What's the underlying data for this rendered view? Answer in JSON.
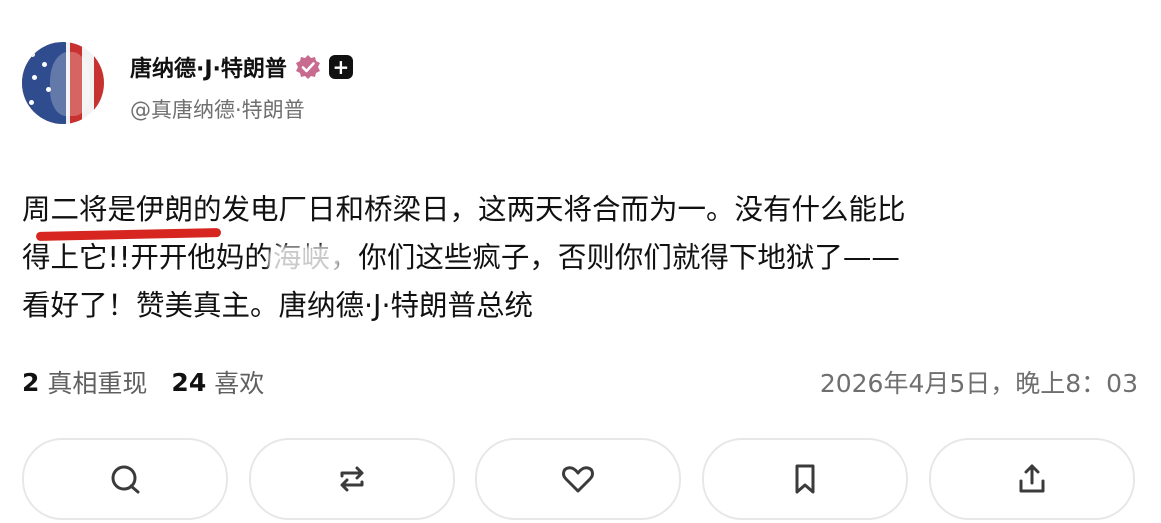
{
  "author": {
    "display_name": "唐纳德·J·特朗普",
    "handle": "@真唐纳德·特朗普",
    "verified_icon": "verified-badge-icon",
    "plus_icon": "plus-box-icon"
  },
  "post": {
    "lines": [
      "周二将是伊朗的发电厂日和桥梁日，这两天将合而为一。没有什么能比",
      "得上它!!开开他妈的海峡，你们这些疯子，否则你们就得下地狱了——",
      "看好了！赞美真主。唐纳德·J·特朗普总统"
    ]
  },
  "stats": {
    "reposts_count": "2",
    "reposts_label": "真相重现",
    "likes_count": "24",
    "likes_label": "喜欢",
    "timestamp": "2026年4月5日，晚上8：03"
  },
  "actions": [
    {
      "name": "reply-button",
      "icon": "comment-icon"
    },
    {
      "name": "repost-button",
      "icon": "repost-icon"
    },
    {
      "name": "like-button",
      "icon": "heart-icon"
    },
    {
      "name": "bookmark-button",
      "icon": "bookmark-icon"
    },
    {
      "name": "share-button",
      "icon": "share-icon"
    }
  ],
  "colors": {
    "text": "#111111",
    "muted": "#6f6f6f",
    "verified": "#c76b8f",
    "annotation_red": "#d6261f"
  }
}
